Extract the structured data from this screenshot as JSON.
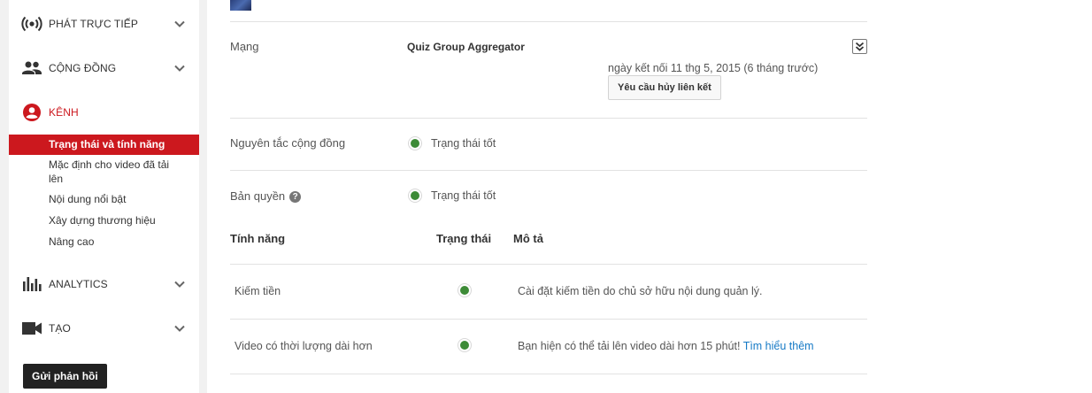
{
  "sidebar": {
    "live": {
      "label": "PHÁT TRỰC TIẾP"
    },
    "community": {
      "label": "CỘNG ĐỒNG"
    },
    "channel": {
      "label": "KÊNH",
      "items": [
        {
          "label": "Trạng thái và tính năng"
        },
        {
          "label": "Mặc định cho video đã tải lên"
        },
        {
          "label": "Nội dung nổi bật"
        },
        {
          "label": "Xây dựng thương hiệu"
        },
        {
          "label": "Nâng cao"
        }
      ]
    },
    "analytics": {
      "label": "ANALYTICS"
    },
    "create": {
      "label": "TẠO"
    },
    "feedback_label": "Gửi phản hồi"
  },
  "network": {
    "label": "Mạng",
    "name": "Quiz Group Aggregator",
    "linked_text": "ngày kết nối 11 thg 5, 2015 (6 tháng trước)",
    "unlink_label": "Yêu cầu hủy liên kết"
  },
  "community_guidelines": {
    "label": "Nguyên tắc cộng đồng",
    "status": "Trạng thái tốt"
  },
  "copyright": {
    "label": "Bản quyền",
    "help": "?",
    "status": "Trạng thái tốt"
  },
  "features": {
    "headers": {
      "feature": "Tính năng",
      "status": "Trạng thái",
      "description": "Mô tả"
    },
    "rows": [
      {
        "name": "Kiếm tiền",
        "description": "Cài đặt kiếm tiền do chủ sở hữu nội dung quản lý.",
        "link": ""
      },
      {
        "name": "Video có thời lượng dài hơn",
        "description": "Bạn hiện có thể tải lên video dài hơn 15 phút! ",
        "link": "Tìm hiểu thêm"
      }
    ]
  },
  "colors": {
    "accent": "#cc181e",
    "status_good": "#3d8b37",
    "link": "#167ac6"
  }
}
